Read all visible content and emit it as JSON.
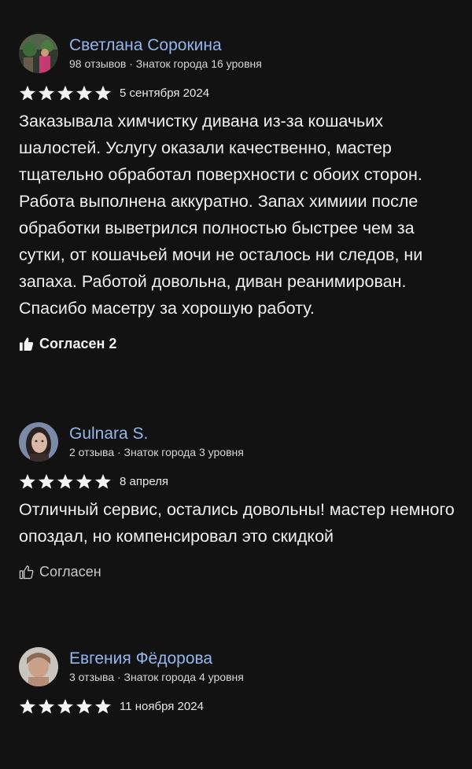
{
  "reviews": [
    {
      "author": "Светлана Сорокина",
      "meta": "98 отзывов · Знаток города 16 уровня",
      "rating": 5,
      "date": "5 сентября 2024",
      "text": "Заказывала химчистку дивана из-за кошачьих шалостей. Услугу оказали качественно, мастер тщательно обработал поверхности с обоих сторон. Работа выполнена аккуратно. Запах химиии после обработки выветрился полностью быстрее чем за сутки, от кошачьей мочи не осталось ни следов, ни запаха. Работой довольна, диван реанимирован. Спасибо масетру за хорошую работу.",
      "agree_label": "Согласен 2"
    },
    {
      "author": "Gulnara S.",
      "meta": "2 отзыва · Знаток города 3 уровня",
      "rating": 5,
      "date": "8 апреля",
      "text": "Отличный сервис, остались довольны! мастер немного опоздал, но компенсировал это скидкой",
      "agree_label": "Согласен"
    },
    {
      "author": "Евгения Фёдорова",
      "meta": "3 отзыва · Знаток города 4 уровня",
      "rating": 5,
      "date": "11 ноября 2024"
    }
  ],
  "colors": {
    "background": "#121212",
    "author_link": "#93b6ee",
    "star": "#f2f2f2"
  }
}
